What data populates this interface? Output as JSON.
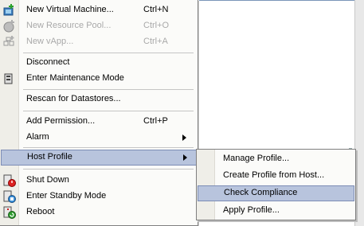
{
  "menu": {
    "items": [
      {
        "label": "New Virtual Machine...",
        "shortcut": "Ctrl+N",
        "enabled": true,
        "icon": "new-vm-icon"
      },
      {
        "label": "New Resource Pool...",
        "shortcut": "Ctrl+O",
        "enabled": false,
        "icon": "resource-pool-icon"
      },
      {
        "label": "New vApp...",
        "shortcut": "Ctrl+A",
        "enabled": false,
        "icon": "vapp-icon"
      },
      {
        "label": "Disconnect",
        "shortcut": "",
        "enabled": true,
        "icon": ""
      },
      {
        "label": "Enter Maintenance Mode",
        "shortcut": "",
        "enabled": true,
        "icon": "maintenance-mode-icon"
      },
      {
        "label": "Rescan for Datastores...",
        "shortcut": "",
        "enabled": true,
        "icon": ""
      },
      {
        "label": "Add Permission...",
        "shortcut": "Ctrl+P",
        "enabled": true,
        "icon": ""
      },
      {
        "label": "Alarm",
        "shortcut": "",
        "enabled": true,
        "icon": "",
        "submenu": true
      },
      {
        "label": "Host Profile",
        "shortcut": "",
        "enabled": true,
        "icon": "",
        "submenu": true,
        "selected": true
      },
      {
        "label": "Shut Down",
        "shortcut": "",
        "enabled": true,
        "icon": "shutdown-icon"
      },
      {
        "label": "Enter Standby Mode",
        "shortcut": "",
        "enabled": true,
        "icon": "standby-icon"
      },
      {
        "label": "Reboot",
        "shortcut": "",
        "enabled": true,
        "icon": "reboot-icon"
      }
    ]
  },
  "host_profile_submenu": {
    "items": [
      {
        "label": "Manage Profile...",
        "selected": false
      },
      {
        "label": "Create Profile from Host...",
        "selected": false
      },
      {
        "label": "Check Compliance",
        "selected": true
      },
      {
        "label": "Apply Profile...",
        "selected": false
      }
    ]
  },
  "colors": {
    "highlight": "#b8c4dd",
    "highlight_border": "#7c8cb5",
    "disabled_text": "#a9a9a9",
    "menu_bg": "#fbfbf9",
    "gutter_bg": "#efeee8"
  }
}
